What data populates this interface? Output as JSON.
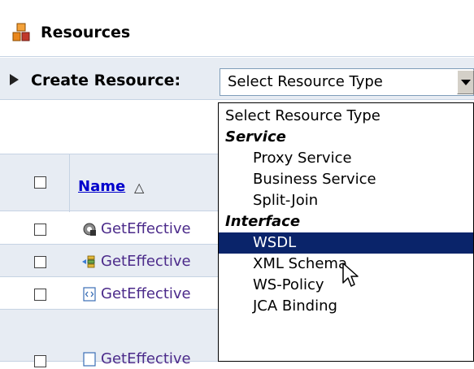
{
  "header": {
    "title": "Resources",
    "icon": "resources-icon"
  },
  "create": {
    "label": "Create Resource:",
    "select_value": "Select Resource Type"
  },
  "table": {
    "name_header": "Name",
    "sort_icon": "△",
    "rows": [
      {
        "icon": "service-gear-icon",
        "text": "GetEffective"
      },
      {
        "icon": "split-join-icon",
        "text": "GetEffective"
      },
      {
        "icon": "wsdl-file-icon",
        "text": "GetEffective"
      },
      {
        "icon": "file-icon",
        "text": "GetEffective"
      }
    ]
  },
  "dropdown": {
    "options": [
      {
        "label": "Select Resource Type",
        "kind": "option"
      },
      {
        "label": "Service",
        "kind": "group"
      },
      {
        "label": "Proxy Service",
        "kind": "item"
      },
      {
        "label": "Business Service",
        "kind": "item"
      },
      {
        "label": "Split-Join",
        "kind": "item"
      },
      {
        "label": "Interface",
        "kind": "group"
      },
      {
        "label": "WSDL",
        "kind": "item",
        "selected": true
      },
      {
        "label": "XML Schema",
        "kind": "item"
      },
      {
        "label": "WS-Policy",
        "kind": "item"
      },
      {
        "label": "JCA Binding",
        "kind": "item"
      }
    ]
  },
  "colors": {
    "accent": "#0a246a",
    "row_alt": "#e7ecf3",
    "link": "#0000cc"
  }
}
